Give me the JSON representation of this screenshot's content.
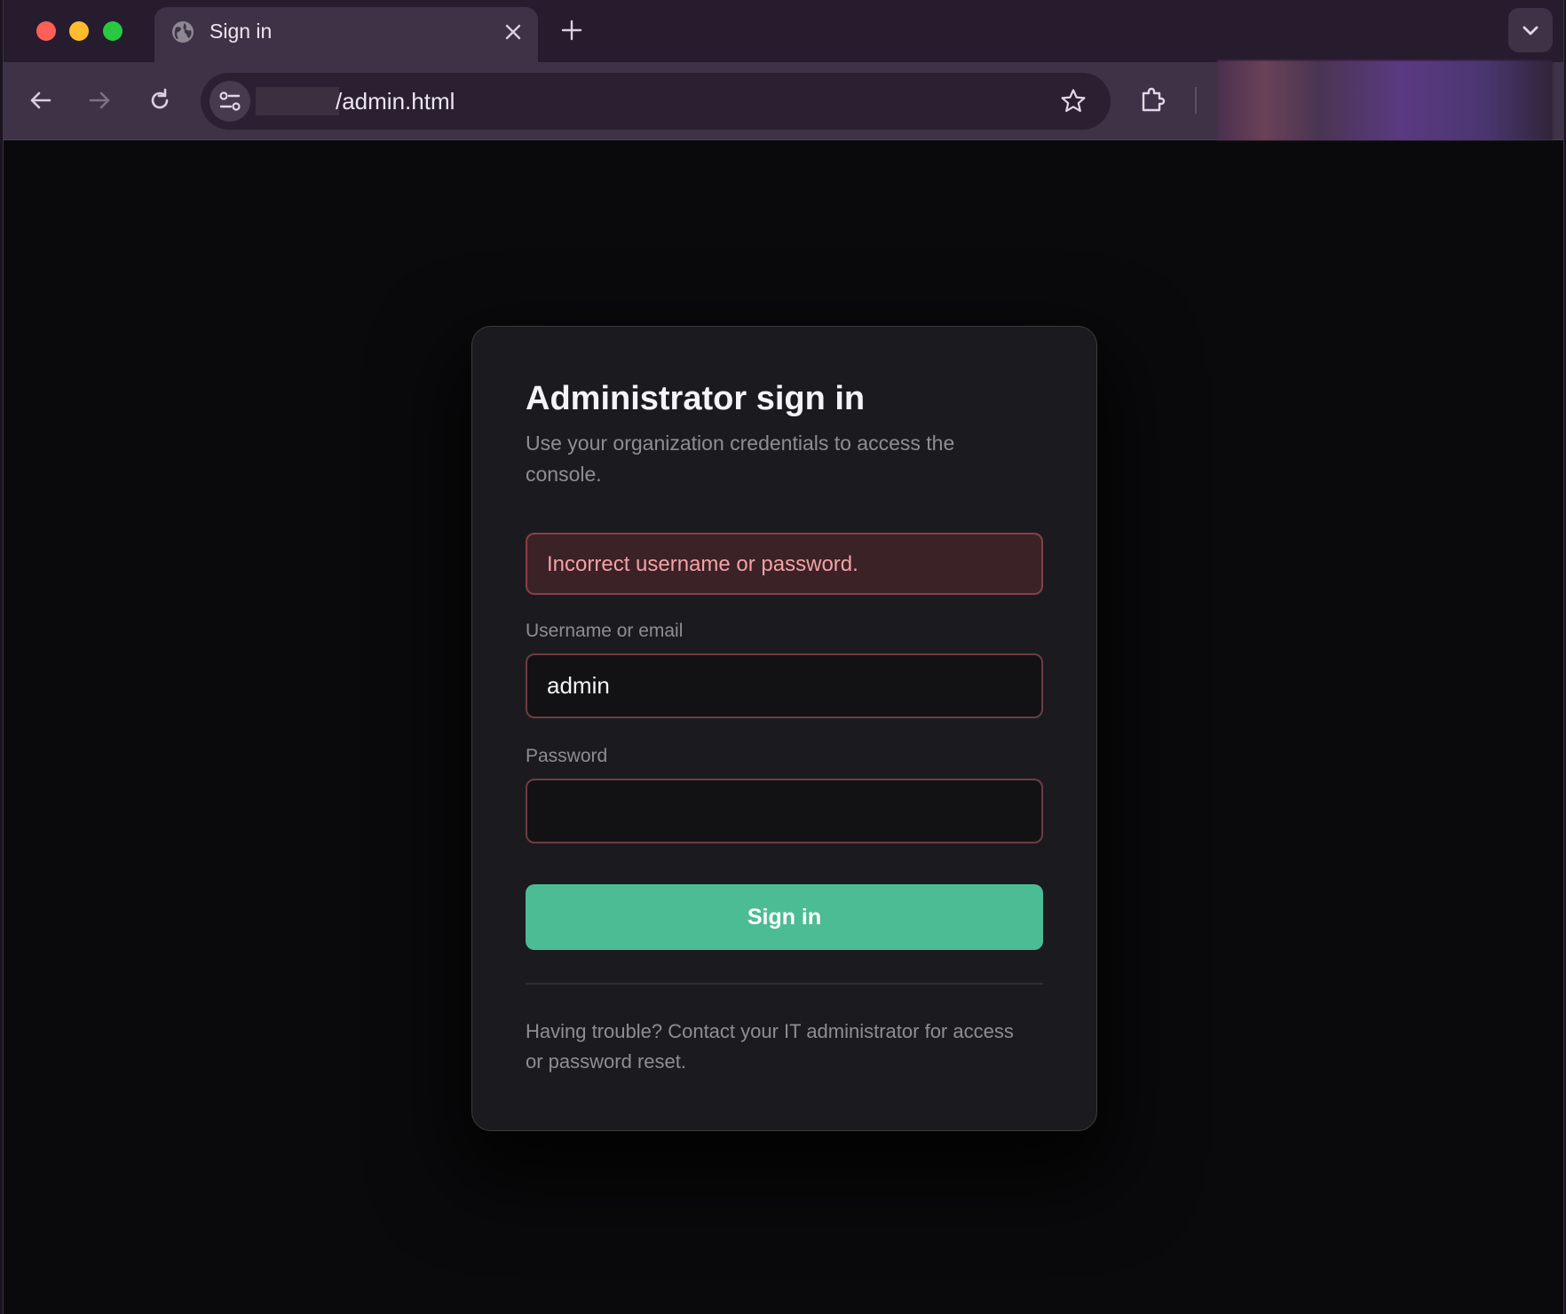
{
  "browser": {
    "tab_title": "Sign in",
    "url": "/admin.html"
  },
  "login": {
    "title": "Administrator sign in",
    "subtitle": "Use your organization credentials to access the console.",
    "error": "Incorrect username or password.",
    "username_label": "Username or email",
    "username_value": "admin",
    "password_label": "Password",
    "password_value": "",
    "submit_label": "Sign in",
    "help_text": "Having trouble? Contact your IT administrator for access or password reset."
  },
  "colors": {
    "accent": "#4cbc95",
    "error_bg": "#3a2226",
    "error_text": "#f3a1a6"
  }
}
